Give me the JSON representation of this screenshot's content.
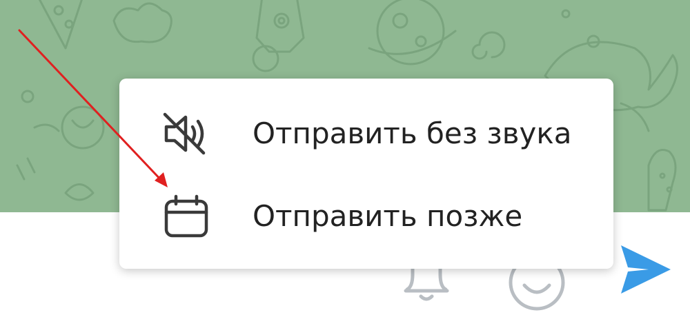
{
  "context_menu": {
    "items": [
      {
        "label": "Отправить без звука",
        "icon": "muted-speaker-icon"
      },
      {
        "label": "Отправить позже",
        "icon": "calendar-icon"
      }
    ]
  },
  "composer": {
    "icons": [
      "bell-icon",
      "emoji-icon",
      "send-icon"
    ],
    "send_color": "#3a9be6"
  },
  "chat_background": {
    "color": "#8fb892",
    "pattern_color": "#7fa883"
  },
  "annotation": {
    "arrow_color": "#e02020"
  }
}
